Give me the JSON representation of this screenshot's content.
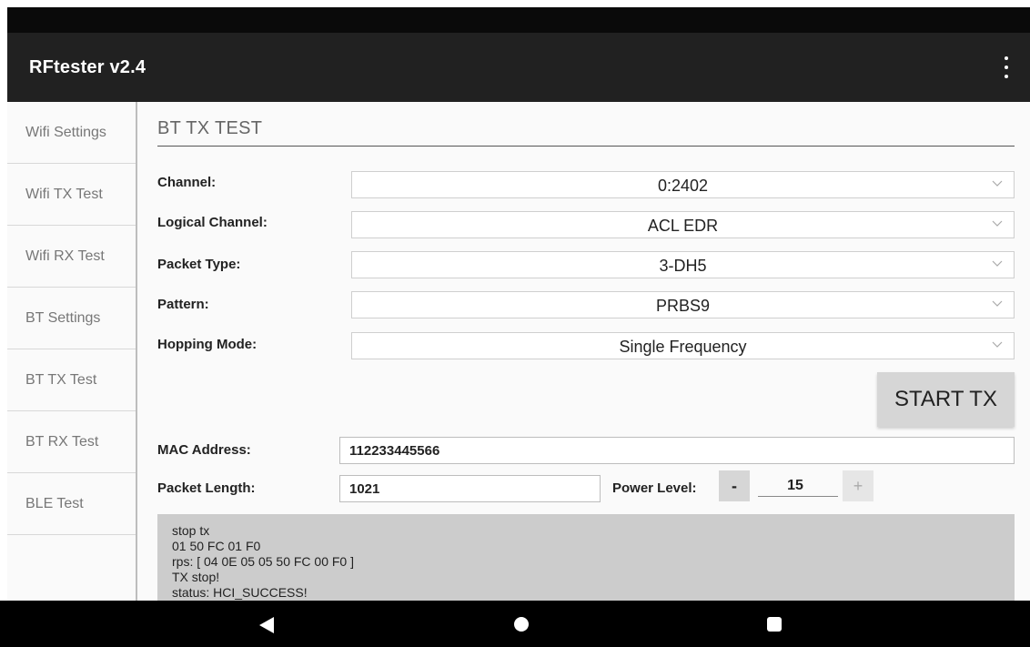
{
  "app": {
    "title": "RFtester v2.4"
  },
  "sidebar": {
    "items": [
      {
        "label": "Wifi Settings"
      },
      {
        "label": "Wifi TX Test"
      },
      {
        "label": "Wifi RX Test"
      },
      {
        "label": "BT Settings"
      },
      {
        "label": "BT TX Test"
      },
      {
        "label": "BT RX Test"
      },
      {
        "label": "BLE Test"
      }
    ]
  },
  "section": {
    "title": "BT TX TEST"
  },
  "form": {
    "channel": {
      "label": "Channel:",
      "value": "0:2402"
    },
    "logical_channel": {
      "label": "Logical Channel:",
      "value": "ACL EDR"
    },
    "packet_type": {
      "label": "Packet Type:",
      "value": "3-DH5"
    },
    "pattern": {
      "label": "Pattern:",
      "value": "PRBS9"
    },
    "hopping_mode": {
      "label": "Hopping Mode:",
      "value": "Single Frequency"
    },
    "start_tx_label": "START TX",
    "mac_address": {
      "label": "MAC Address:",
      "value": "112233445566"
    },
    "packet_length": {
      "label": "Packet Length:",
      "value": "1021"
    },
    "power_level": {
      "label": "Power Level:",
      "value": "15",
      "minus_label": "-",
      "plus_label": "+"
    }
  },
  "console": {
    "lines": [
      "stop tx",
      "01 50 FC 01 F0",
      "rps: [ 04 0E 05 05 50 FC 00 F0 ]",
      "TX stop!",
      "status: HCI_SUCCESS!"
    ]
  },
  "icons": {
    "overflow": "more-vert-icon",
    "chevron": "chevron-down-icon",
    "back": "nav-back-icon",
    "home": "nav-home-icon",
    "recents": "nav-recents-icon"
  },
  "colors": {
    "app_bar": "#212121",
    "status_bar": "#0a0a0a",
    "button": "#d6d6d6",
    "console_bg": "#cccccc"
  }
}
